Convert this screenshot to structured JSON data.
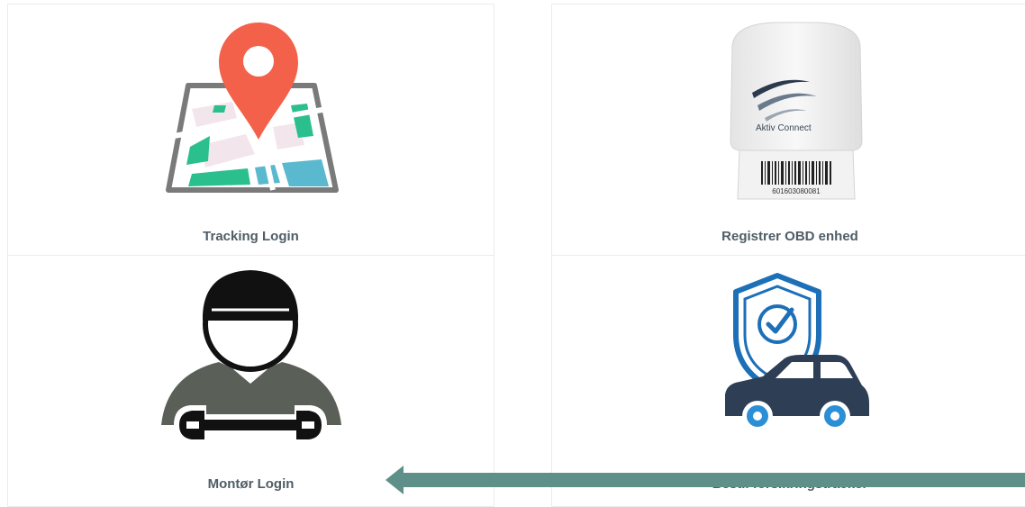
{
  "tiles": [
    {
      "label": "Tracking Login",
      "icon": "map-pin-icon"
    },
    {
      "label": "Registrer OBD enhed",
      "icon": "obd-device-icon",
      "device_brand": "Aktiv Connect",
      "barcode_number": "601603080081"
    },
    {
      "label": "Montør Login",
      "icon": "mechanic-icon"
    },
    {
      "label": "Bestil forsikringstracker",
      "icon": "shield-car-icon"
    }
  ],
  "colors": {
    "label_text": "#4f5d66",
    "pin_red": "#f4614a",
    "map_green": "#2bbf8e",
    "map_blue": "#5ab8cf",
    "map_frame": "#7a7a7a",
    "mechanic_body": "#5a5f57",
    "shield_blue": "#1d6fb8",
    "car_navy": "#2d3e55",
    "wheel_blue": "#2b8fd6",
    "arrow_teal": "#5e8f88",
    "tile_border": "#ececec"
  }
}
